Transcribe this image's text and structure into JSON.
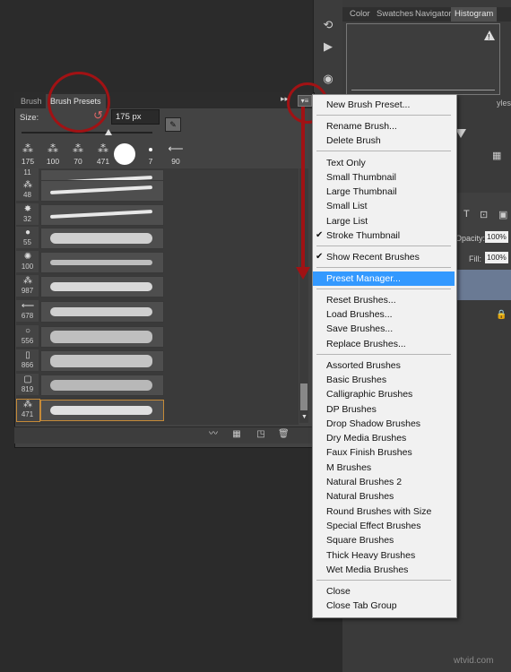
{
  "right_panel": {
    "tabs": [
      "Color",
      "Swatches",
      "Navigator",
      "Histogram"
    ],
    "active_tab": "Histogram",
    "styles_tab": "yles",
    "opacity_label": "Opacity:",
    "opacity_value": "100%",
    "fill_label": "Fill:",
    "fill_value": "100%"
  },
  "brush_panel": {
    "tabs": [
      "Brush",
      "Brush Presets"
    ],
    "active_tab": "Brush Presets",
    "size_label": "Size:",
    "size_value": "175 px",
    "recent_brushes": [
      "175",
      "100",
      "70",
      "471",
      "",
      "7",
      "90"
    ],
    "presets": [
      {
        "size": "11"
      },
      {
        "size": "48"
      },
      {
        "size": "32"
      },
      {
        "size": "55"
      },
      {
        "size": "100"
      },
      {
        "size": "987"
      },
      {
        "size": "678"
      },
      {
        "size": "556"
      },
      {
        "size": "866"
      },
      {
        "size": "819"
      },
      {
        "size": "471"
      }
    ]
  },
  "menu": {
    "items": [
      {
        "label": "New Brush Preset...",
        "checked": false,
        "highlight": false
      },
      {
        "label": "Rename Brush...",
        "checked": false,
        "highlight": false
      },
      {
        "label": "Delete Brush",
        "checked": false,
        "highlight": false
      },
      {
        "label": "Text Only",
        "checked": false,
        "highlight": false
      },
      {
        "label": "Small Thumbnail",
        "checked": false,
        "highlight": false
      },
      {
        "label": "Large Thumbnail",
        "checked": false,
        "highlight": false
      },
      {
        "label": "Small List",
        "checked": false,
        "highlight": false
      },
      {
        "label": "Large List",
        "checked": false,
        "highlight": false
      },
      {
        "label": "Stroke Thumbnail",
        "checked": true,
        "highlight": false
      },
      {
        "label": "Show Recent Brushes",
        "checked": true,
        "highlight": false
      },
      {
        "label": "Preset Manager...",
        "checked": false,
        "highlight": true
      },
      {
        "label": "Reset Brushes...",
        "checked": false,
        "highlight": false
      },
      {
        "label": "Load Brushes...",
        "checked": false,
        "highlight": false
      },
      {
        "label": "Save Brushes...",
        "checked": false,
        "highlight": false
      },
      {
        "label": "Replace Brushes...",
        "checked": false,
        "highlight": false
      },
      {
        "label": "Assorted Brushes",
        "checked": false,
        "highlight": false
      },
      {
        "label": "Basic Brushes",
        "checked": false,
        "highlight": false
      },
      {
        "label": "Calligraphic Brushes",
        "checked": false,
        "highlight": false
      },
      {
        "label": "DP Brushes",
        "checked": false,
        "highlight": false
      },
      {
        "label": "Drop Shadow Brushes",
        "checked": false,
        "highlight": false
      },
      {
        "label": "Dry Media Brushes",
        "checked": false,
        "highlight": false
      },
      {
        "label": "Faux Finish Brushes",
        "checked": false,
        "highlight": false
      },
      {
        "label": "M Brushes",
        "checked": false,
        "highlight": false
      },
      {
        "label": "Natural Brushes 2",
        "checked": false,
        "highlight": false
      },
      {
        "label": "Natural Brushes",
        "checked": false,
        "highlight": false
      },
      {
        "label": "Round Brushes with Size",
        "checked": false,
        "highlight": false
      },
      {
        "label": "Special Effect Brushes",
        "checked": false,
        "highlight": false
      },
      {
        "label": "Square Brushes",
        "checked": false,
        "highlight": false
      },
      {
        "label": "Thick Heavy Brushes",
        "checked": false,
        "highlight": false
      },
      {
        "label": "Wet Media Brushes",
        "checked": false,
        "highlight": false
      },
      {
        "label": "Close",
        "checked": false,
        "highlight": false
      },
      {
        "label": "Close Tab Group",
        "checked": false,
        "highlight": false
      }
    ]
  },
  "colors": {
    "annotation": "#a11214",
    "highlight": "#3399ff"
  },
  "watermark": "wtvid.com"
}
